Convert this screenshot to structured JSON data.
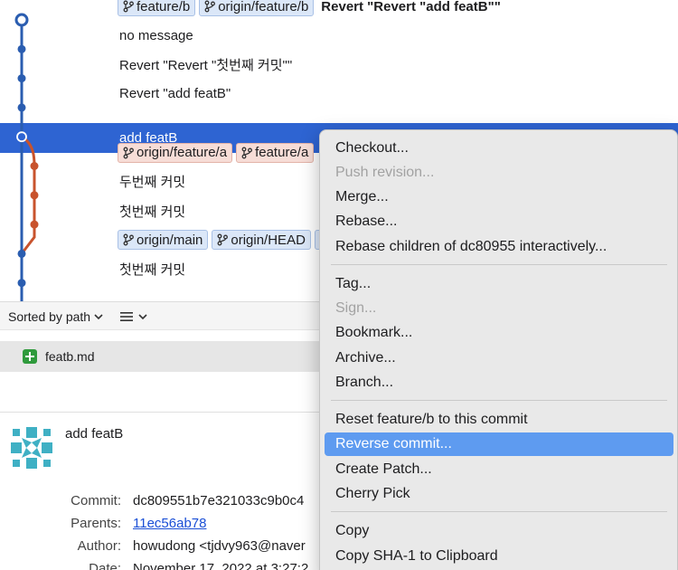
{
  "commits": [
    {
      "tags": [
        {
          "label": "feature/b",
          "color": "blue"
        },
        {
          "label": "origin/feature/b",
          "color": "blue"
        }
      ],
      "message": "Revert \"Revert \"add featB\"\"",
      "bold": true
    },
    {
      "tags": [],
      "message": "no message"
    },
    {
      "tags": [],
      "message": "Revert \"Revert \"첫번째 커밋\"\""
    },
    {
      "tags": [],
      "message": "Revert \"add featB\""
    },
    {
      "tags": [],
      "message": "add featB",
      "selected": true
    },
    {
      "tags": [
        {
          "label": "origin/feature/a",
          "color": "red"
        },
        {
          "label": "feature/a",
          "color": "red"
        }
      ],
      "message": ""
    },
    {
      "tags": [],
      "message": "두번째 커밋"
    },
    {
      "tags": [],
      "message": "첫번째 커밋"
    },
    {
      "tags": [
        {
          "label": "origin/main",
          "color": "blue"
        },
        {
          "label": "origin/HEAD",
          "color": "blue"
        }
      ],
      "message": ""
    },
    {
      "tags": [],
      "message": "첫번째 커밋"
    }
  ],
  "graph_colors": {
    "main": "#2a5db0",
    "feature": "#c8532d"
  },
  "toolbar": {
    "sort_label": "Sorted by path",
    "sort_icon": "chevron-down-icon",
    "view_icon": "list-icon"
  },
  "file_list": [
    {
      "name": "featb.md",
      "status_icon": "file-added-icon"
    }
  ],
  "details": {
    "subject": "add featB",
    "commit_label": "Commit:",
    "commit_value": "dc809551b7e321033c9b0c4",
    "parents_label": "Parents:",
    "parents_value": "11ec56ab78",
    "author_label": "Author:",
    "author_value": "howudong <tjdvy963@naver",
    "date_label": "Date:",
    "date_value": "November 17, 2022 at 3:27:2"
  },
  "context_menu": {
    "items": [
      {
        "label": "Checkout...",
        "enabled": true
      },
      {
        "label": "Push revision...",
        "enabled": false
      },
      {
        "label": "Merge...",
        "enabled": true
      },
      {
        "label": "Rebase...",
        "enabled": true
      },
      {
        "label": "Rebase children of dc80955 interactively...",
        "enabled": true
      },
      {
        "label": "Tag...",
        "enabled": true
      },
      {
        "label": "Sign...",
        "enabled": false
      },
      {
        "label": "Bookmark...",
        "enabled": true
      },
      {
        "label": "Archive...",
        "enabled": true
      },
      {
        "label": "Branch...",
        "enabled": true
      },
      {
        "label": "Reset feature/b to this commit",
        "enabled": true
      },
      {
        "label": "Reverse commit...",
        "enabled": true,
        "highlighted": true
      },
      {
        "label": "Create Patch...",
        "enabled": true
      },
      {
        "label": "Cherry Pick",
        "enabled": true
      },
      {
        "label": "Copy",
        "enabled": true
      },
      {
        "label": "Copy SHA-1 to Clipboard",
        "enabled": true
      }
    ],
    "highlight_color": "#5e9bf0"
  }
}
